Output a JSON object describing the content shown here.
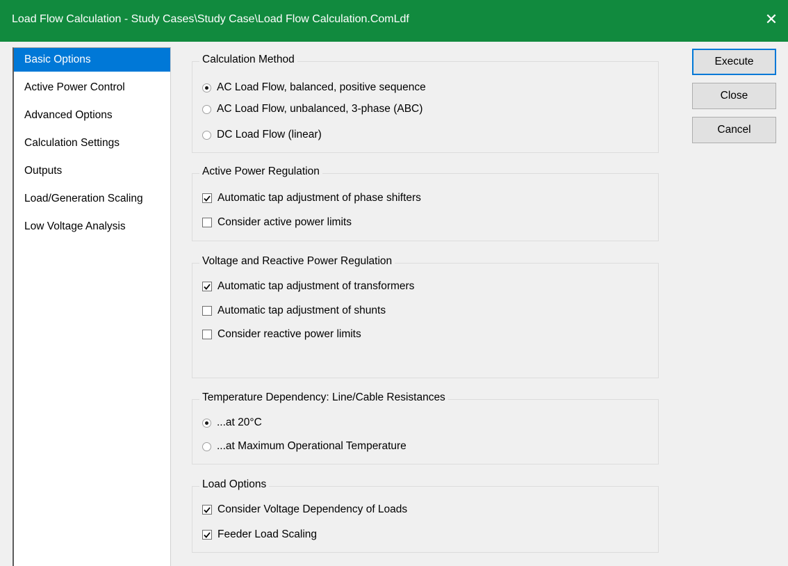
{
  "window": {
    "title": "Load Flow Calculation - Study Cases\\Study Case\\Load Flow Calculation.ComLdf",
    "close_glyph": "✕",
    "accent": "#118a3e"
  },
  "nav": {
    "items": [
      {
        "label": "Basic Options",
        "selected": true
      },
      {
        "label": "Active Power Control",
        "selected": false
      },
      {
        "label": "Advanced Options",
        "selected": false
      },
      {
        "label": "Calculation Settings",
        "selected": false
      },
      {
        "label": "Outputs",
        "selected": false
      },
      {
        "label": "Load/Generation Scaling",
        "selected": false
      },
      {
        "label": "Low Voltage Analysis",
        "selected": false
      }
    ],
    "selected_color": "#0078d7"
  },
  "groups": {
    "calc_method": {
      "title": "Calculation Method",
      "options": [
        {
          "label": "AC Load Flow, balanced, positive sequence",
          "checked": true
        },
        {
          "label": "AC Load Flow, unbalanced, 3-phase (ABC)",
          "checked": false
        },
        {
          "label": "DC Load Flow (linear)",
          "checked": false
        }
      ]
    },
    "active_power": {
      "title": "Active Power Regulation",
      "options": [
        {
          "label": "Automatic tap adjustment of phase shifters",
          "checked": true
        },
        {
          "label": "Consider active power limits",
          "checked": false
        }
      ]
    },
    "voltage_reactive": {
      "title": "Voltage and Reactive Power Regulation",
      "options": [
        {
          "label": "Automatic tap adjustment of transformers",
          "checked": true
        },
        {
          "label": "Automatic tap adjustment of shunts",
          "checked": false
        },
        {
          "label": "Consider reactive power limits",
          "checked": false
        }
      ]
    },
    "temperature": {
      "title": "Temperature Dependency: Line/Cable Resistances",
      "options": [
        {
          "label": "...at 20°C",
          "checked": true
        },
        {
          "label": "...at Maximum Operational Temperature",
          "checked": false
        }
      ]
    },
    "load_options": {
      "title": "Load Options",
      "options": [
        {
          "label": "Consider Voltage Dependency of Loads",
          "checked": true
        },
        {
          "label": "Feeder Load Scaling",
          "checked": true
        }
      ]
    }
  },
  "buttons": {
    "execute": "Execute",
    "close": "Close",
    "cancel": "Cancel"
  }
}
